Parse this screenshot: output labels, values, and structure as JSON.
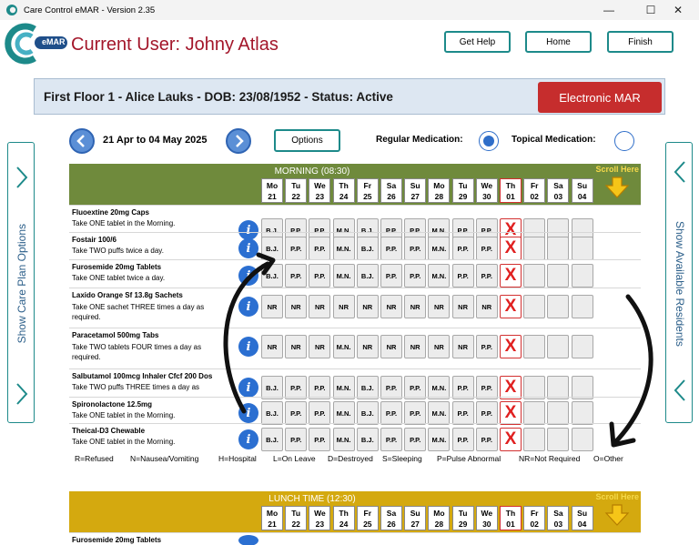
{
  "window": {
    "title": "Care Control eMAR - Version 2.35",
    "controls": {
      "minimize": "—",
      "maximize": "☐",
      "close": "✕"
    }
  },
  "header": {
    "logo_text": "eMAR",
    "current_user": "Current User: Johny Atlas",
    "buttons": {
      "help": "Get Help",
      "home": "Home",
      "finish": "Finish"
    }
  },
  "resident": {
    "info": "First Floor 1 - Alice Lauks - DOB: 23/08/1952 - Status: Active",
    "mode_button": "Electronic MAR"
  },
  "toolbar": {
    "date_range": "21 Apr to 04 May 2025",
    "options_label": "Options",
    "regular_label": "Regular Medication:",
    "topical_label": "Topical Medication:",
    "regular_selected": true,
    "topical_selected": false
  },
  "side_panels": {
    "left_label": "Show Care Plan Options",
    "right_label": "Show Available Residents"
  },
  "colors": {
    "morning_header": "#6f8a3c",
    "lunch_header": "#d4a90f",
    "accent_teal": "#1d8a8a",
    "alert_red": "#c62d2d"
  },
  "days": [
    {
      "dow": "Mo",
      "num": "21"
    },
    {
      "dow": "Tu",
      "num": "22"
    },
    {
      "dow": "We",
      "num": "23"
    },
    {
      "dow": "Th",
      "num": "24"
    },
    {
      "dow": "Fr",
      "num": "25"
    },
    {
      "dow": "Sa",
      "num": "26"
    },
    {
      "dow": "Su",
      "num": "27"
    },
    {
      "dow": "Mo",
      "num": "28"
    },
    {
      "dow": "Tu",
      "num": "29"
    },
    {
      "dow": "We",
      "num": "30"
    },
    {
      "dow": "Th",
      "num": "01"
    },
    {
      "dow": "Fr",
      "num": "02"
    },
    {
      "dow": "Sa",
      "num": "03"
    },
    {
      "dow": "Su",
      "num": "04"
    }
  ],
  "today_index": 10,
  "scroll_here": "Scroll Here",
  "sections": [
    {
      "title": "MORNING (08:30)",
      "medications": [
        {
          "name": "Fluoextine 20mg Caps",
          "instructions": "Take ONE tablet in the Morning.",
          "cells": [
            "B.J.",
            "P.P.",
            "P.P.",
            "M.N.",
            "B.J.",
            "P.P.",
            "P.P.",
            "M.N.",
            "P.P.",
            "P.P."
          ]
        },
        {
          "name": "Fostair 100/6",
          "instructions": "Take TWO puffs twice a day.",
          "cells": [
            "B.J.",
            "P.P.",
            "P.P.",
            "M.N.",
            "B.J.",
            "P.P.",
            "P.P.",
            "M.N.",
            "P.P.",
            "P.P."
          ]
        },
        {
          "name": "Furosemide 20mg Tablets",
          "instructions": "Take ONE tablet twice a day.",
          "cells": [
            "B.J.",
            "P.P.",
            "P.P.",
            "M.N.",
            "B.J.",
            "P.P.",
            "P.P.",
            "M.N.",
            "P.P.",
            "P.P."
          ]
        },
        {
          "name": "Laxido Orange Sf 13.8g Sachets",
          "instructions": "Take ONE sachet THREE times a day as required.",
          "cells": [
            "NR",
            "NR",
            "NR",
            "NR",
            "NR",
            "NR",
            "NR",
            "NR",
            "NR",
            "NR"
          ]
        },
        {
          "name": "Paracetamol 500mg Tabs",
          "instructions": "Take TWO tablets FOUR times a day as required.",
          "cells": [
            "NR",
            "NR",
            "NR",
            "M.N.",
            "NR",
            "NR",
            "NR",
            "NR",
            "NR",
            "P.P."
          ]
        },
        {
          "name": "Salbutamol 100mcg Inhaler Cfcf 200 Dos",
          "instructions": "Take TWO puffs THREE times a day as",
          "cells": [
            "B.J.",
            "P.P.",
            "P.P.",
            "M.N.",
            "B.J.",
            "P.P.",
            "P.P.",
            "M.N.",
            "P.P.",
            "P.P."
          ]
        },
        {
          "name": "Spironolactone 12.5mg",
          "instructions": "Take ONE tablet in the Morning.",
          "cells": [
            "B.J.",
            "P.P.",
            "P.P.",
            "M.N.",
            "B.J.",
            "P.P.",
            "P.P.",
            "M.N.",
            "P.P.",
            "P.P."
          ]
        },
        {
          "name": "Theical-D3 Chewable",
          "instructions": "Take ONE tablet in the Morning.",
          "cells": [
            "B.J.",
            "P.P.",
            "P.P.",
            "M.N.",
            "B.J.",
            "P.P.",
            "P.P.",
            "M.N.",
            "P.P.",
            "P.P."
          ]
        }
      ]
    },
    {
      "title": "LUNCH TIME (12:30)",
      "medications": [
        {
          "name": "Furosemide 20mg Tablets",
          "instructions": "",
          "cells": []
        }
      ]
    }
  ],
  "missed_marker": "X",
  "info_glyph": "i",
  "legend": [
    "R=Refused",
    "N=Nausea/Vomiting",
    "H=Hospital",
    "L=On Leave",
    "D=Destroyed",
    "S=Sleeping",
    "P=Pulse Abnormal",
    "NR=Not Required",
    "O=Other"
  ]
}
